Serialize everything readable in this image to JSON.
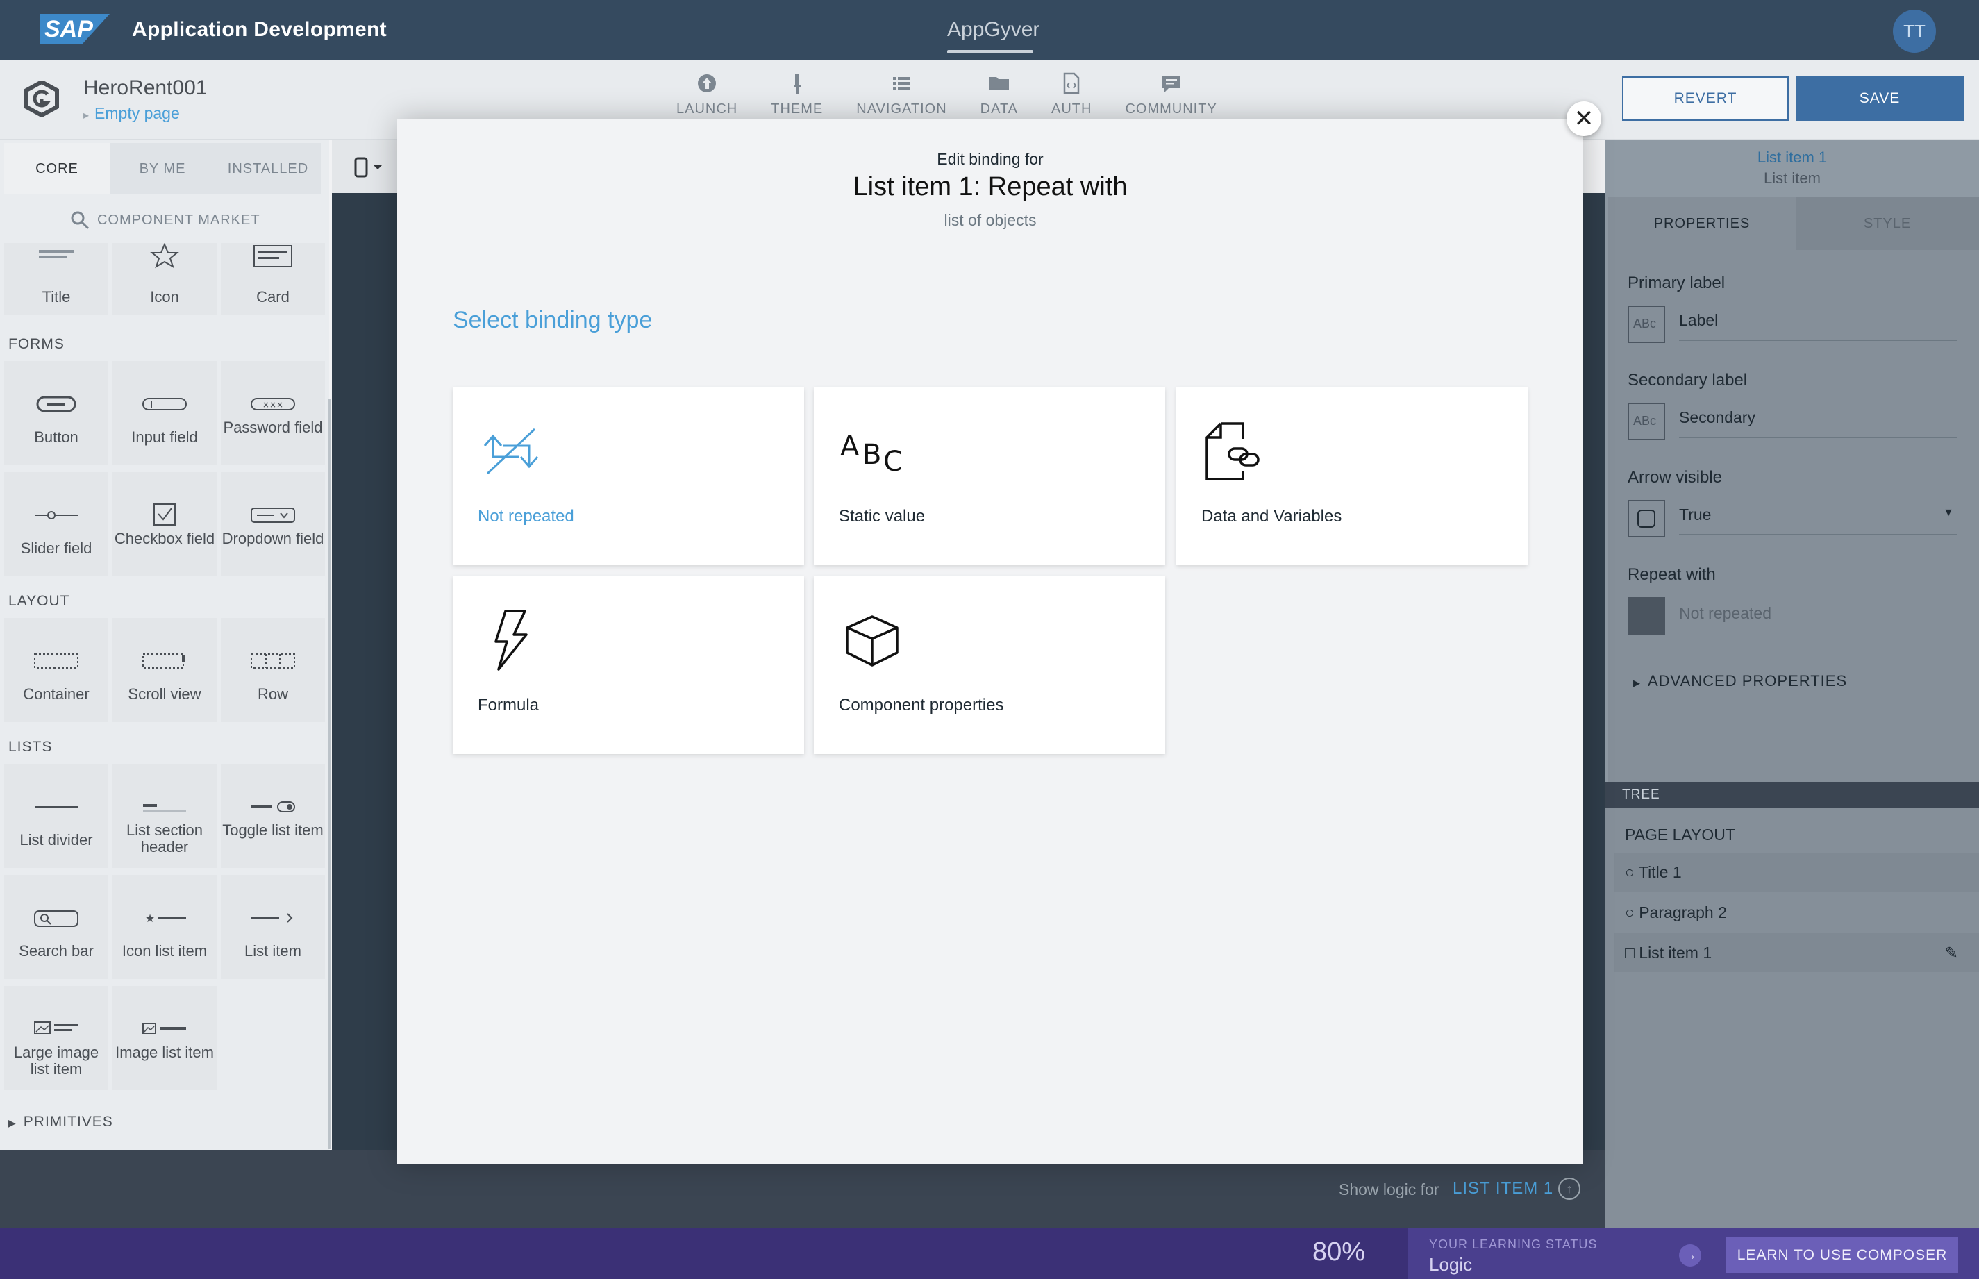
{
  "shell": {
    "logo_text": "SAP",
    "title": "Application Development",
    "center_tab": "AppGyver",
    "avatar_initials": "TT"
  },
  "app": {
    "project_name": "HeroRent001",
    "page_name": "Empty page",
    "nav": [
      {
        "label": "LAUNCH",
        "icon": "upload-icon"
      },
      {
        "label": "THEME",
        "icon": "brush-icon"
      },
      {
        "label": "NAVIGATION",
        "icon": "list-icon"
      },
      {
        "label": "DATA",
        "icon": "folder-icon"
      },
      {
        "label": "AUTH",
        "icon": "auth-document-icon"
      },
      {
        "label": "COMMUNITY",
        "icon": "chat-icon"
      }
    ],
    "revert_label": "REVERT",
    "save_label": "SAVE"
  },
  "left": {
    "tabs": [
      "CORE",
      "BY ME",
      "INSTALLED"
    ],
    "market_label": "COMPONENT MARKET",
    "basic_tiles": [
      "Title",
      "Icon",
      "Card"
    ],
    "forms_label": "FORMS",
    "forms_tiles": [
      "Button",
      "Input field",
      "Password field",
      "Slider field",
      "Checkbox field",
      "Dropdown field"
    ],
    "layout_label": "LAYOUT",
    "layout_tiles": [
      "Container",
      "Scroll view",
      "Row"
    ],
    "lists_label": "LISTS",
    "lists_tiles": [
      "List divider",
      "List section header",
      "Toggle list item",
      "Search bar",
      "Icon list item",
      "List item",
      "Large image list item",
      "Image list item"
    ],
    "primitives_label": "PRIMITIVES"
  },
  "canvas": {
    "show_logic_label": "Show logic for",
    "show_logic_target": "LIST ITEM 1"
  },
  "right": {
    "selected_title": "List item 1",
    "selected_subtitle": "List item",
    "tabs": [
      "PROPERTIES",
      "STYLE"
    ],
    "fields": [
      {
        "label": "Primary label",
        "value": "Label",
        "icon": "text-abc-icon"
      },
      {
        "label": "Secondary label",
        "value": "Secondary",
        "icon": "text-abc-icon"
      },
      {
        "label": "Arrow visible",
        "value": "True",
        "icon": "toggle-icon"
      },
      {
        "label": "Repeat with",
        "value": "Not repeated",
        "icon": "not-repeated-icon"
      }
    ],
    "advanced_label": "ADVANCED PROPERTIES",
    "tree_label": "TREE",
    "page_layout_label": "PAGE LAYOUT",
    "tree_items": [
      "Title 1",
      "Paragraph 2",
      "List item 1"
    ]
  },
  "learning": {
    "percent": "80%",
    "status_label": "YOUR LEARNING STATUS",
    "status_value": "Logic",
    "button_label": "LEARN TO USE COMPOSER"
  },
  "modal": {
    "pre_title": "Edit binding for",
    "title": "List item 1: Repeat with",
    "subtitle": "list of objects",
    "section_title": "Select binding type",
    "options": [
      {
        "label": "Not repeated",
        "icon": "not-repeated-icon",
        "selected": true
      },
      {
        "label": "Static value",
        "icon": "abc-icon",
        "selected": false
      },
      {
        "label": "Data and Variables",
        "icon": "data-link-icon",
        "selected": false
      },
      {
        "label": "Formula",
        "icon": "lightning-icon",
        "selected": false
      },
      {
        "label": "Component properties",
        "icon": "cube-icon",
        "selected": false
      }
    ]
  },
  "colors": {
    "accent": "#4a9fd8",
    "shell": "#354a5f",
    "primary_button": "#3d6ea3",
    "learning_bar": "#3b3076"
  }
}
